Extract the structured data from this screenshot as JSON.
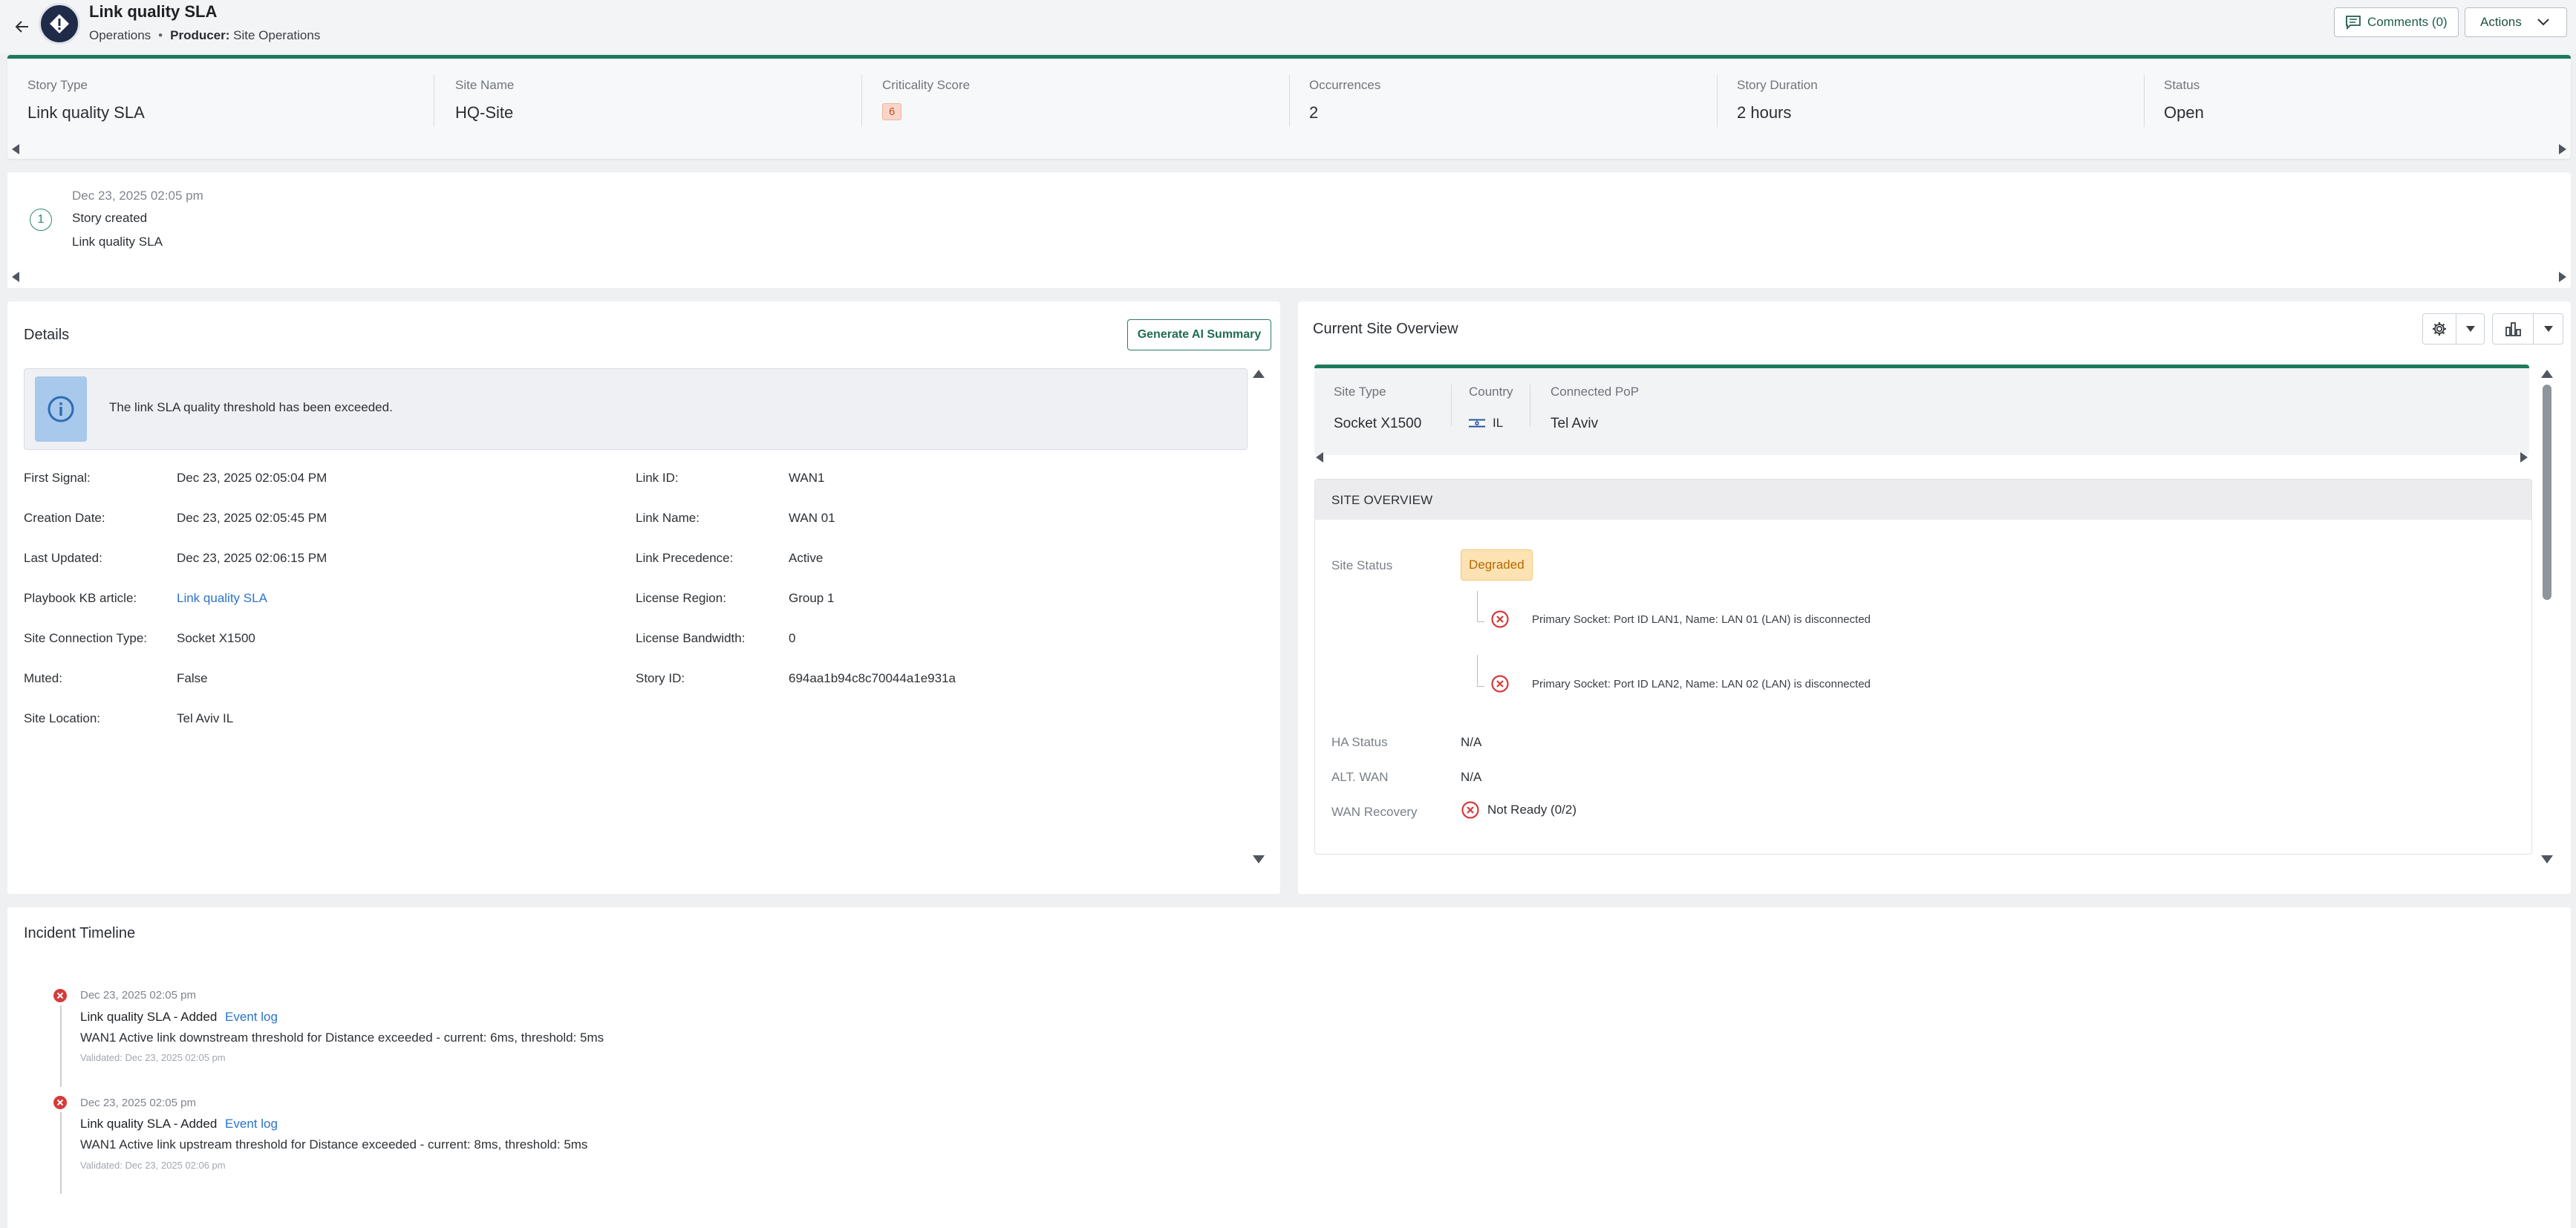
{
  "header": {
    "title": "Link quality SLA",
    "category": "Operations",
    "separator": "•",
    "producer_label": "Producer:",
    "producer_value": "Site Operations",
    "comments_label": "Comments (0)",
    "actions_label": "Actions"
  },
  "summary": {
    "story_type_label": "Story Type",
    "story_type_value": "Link quality SLA",
    "site_name_label": "Site Name",
    "site_name_value": "HQ-Site",
    "criticality_label": "Criticality Score",
    "criticality_value": "6",
    "occurrences_label": "Occurrences",
    "occurrences_value": "2",
    "duration_label": "Story Duration",
    "duration_value": "2 hours",
    "status_label": "Status",
    "status_value": "Open"
  },
  "story_events": {
    "number": "1",
    "date": "Dec 23, 2025 02:05 pm",
    "title": "Story created",
    "subtitle": "Link quality SLA"
  },
  "details": {
    "title": "Details",
    "ai_button": "Generate AI Summary",
    "info_message": "The link SLA quality threshold has been exceeded.",
    "left": [
      {
        "label": "First Signal:",
        "value": "Dec 23, 2025 02:05:04 PM"
      },
      {
        "label": "Creation Date:",
        "value": "Dec 23, 2025 02:05:45 PM"
      },
      {
        "label": "Last Updated:",
        "value": "Dec 23, 2025 02:06:15 PM"
      },
      {
        "label": "Playbook KB article:",
        "value": "Link quality SLA"
      },
      {
        "label": "Site Connection Type:",
        "value": "Socket X1500"
      },
      {
        "label": "Muted:",
        "value": "False"
      },
      {
        "label": "Site Location:",
        "value": "Tel Aviv IL"
      }
    ],
    "right": [
      {
        "label": "Link ID:",
        "value": "WAN1"
      },
      {
        "label": "Link Name:",
        "value": "WAN 01"
      },
      {
        "label": "Link Precedence:",
        "value": "Active"
      },
      {
        "label": "License Region:",
        "value": "Group 1"
      },
      {
        "label": "License Bandwidth:",
        "value": "0"
      },
      {
        "label": "Story ID:",
        "value": "694aa1b94c8c70044a1e931a"
      }
    ]
  },
  "overview": {
    "title": "Current Site Overview",
    "site_type_label": "Site Type",
    "site_type_value": "Socket X1500",
    "country_label": "Country",
    "country_value": "IL",
    "pop_label": "Connected PoP",
    "pop_value": "Tel Aviv",
    "section_title": "SITE OVERVIEW",
    "site_status_label": "Site Status",
    "site_status_value": "Degraded",
    "errors": [
      "Primary Socket: Port ID LAN1, Name: LAN 01 (LAN) is disconnected",
      "Primary Socket: Port ID LAN2, Name: LAN 02 (LAN) is disconnected"
    ],
    "ha_status_label": "HA Status",
    "ha_status_value": "N/A",
    "alt_wan_label": "ALT. WAN",
    "alt_wan_value": "N/A",
    "wan_recovery_label": "WAN Recovery",
    "wan_recovery_value": "Not Ready (0/2)"
  },
  "timeline": {
    "title": "Incident Timeline",
    "items": [
      {
        "date": "Dec 23, 2025 02:05 pm",
        "title": "Link quality SLA - Added",
        "link": "Event log",
        "desc": "WAN1 Active link downstream threshold for Distance exceeded - current: 6ms, threshold: 5ms",
        "validated": "Validated: Dec 23, 2025 02:05 pm"
      },
      {
        "date": "Dec 23, 2025 02:05 pm",
        "title": "Link quality SLA - Added",
        "link": "Event log",
        "desc": "WAN1 Active link upstream threshold for Distance exceeded - current: 8ms, threshold: 5ms",
        "validated": "Validated: Dec 23, 2025 02:06 pm"
      }
    ]
  }
}
